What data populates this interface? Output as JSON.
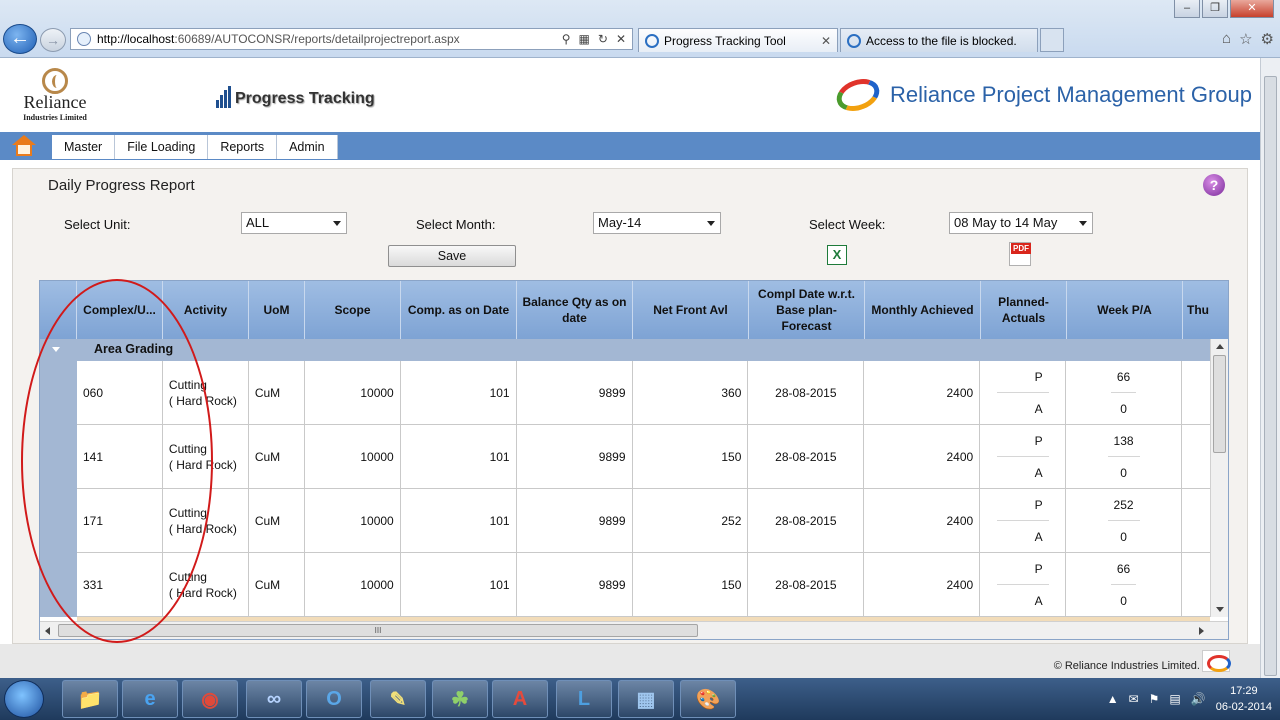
{
  "browser": {
    "url_host": "http://localhost",
    "url_rest": ":60689/AUTOCONSR/reports/detailprojectreport.aspx",
    "tabs": [
      {
        "label": "Progress Tracking Tool"
      },
      {
        "label": "Access to the file is blocked."
      }
    ]
  },
  "header": {
    "company_name": "Reliance",
    "company_sub": "Industries Limited",
    "app_title": "Progress Tracking",
    "brand": "Reliance Project Management Group"
  },
  "menu": [
    "Master",
    "File Loading",
    "Reports",
    "Admin"
  ],
  "report": {
    "title": "Daily Progress Report",
    "unit_label": "Select Unit:",
    "unit_value": "ALL",
    "month_label": "Select Month:",
    "month_value": "May-14",
    "week_label": "Select Week:",
    "week_value": "08 May to 14 May",
    "save_label": "Save"
  },
  "grid": {
    "columns": [
      "Complex/U...",
      "Activity",
      "UoM",
      "Scope",
      "Comp. as on Date",
      "Balance Qty as on date",
      "Net Front Avl",
      "Compl Date w.r.t. Base plan-Forecast",
      "Monthly Achieved",
      "Planned-Actuals",
      "Week P/A",
      "Thu"
    ],
    "group": "Area Grading",
    "rows": [
      {
        "complex": "060",
        "activity": "Cutting\n( Hard Rock)",
        "uom": "CuM",
        "scope": "10000",
        "comp": "101",
        "balance": "9899",
        "net_front": "360",
        "compl_date": "28-08-2015",
        "monthly": "2400",
        "p_label": "P",
        "a_label": "A",
        "week_p": "66",
        "week_a": "0"
      },
      {
        "complex": "141",
        "activity": "Cutting\n( Hard Rock)",
        "uom": "CuM",
        "scope": "10000",
        "comp": "101",
        "balance": "9899",
        "net_front": "150",
        "compl_date": "28-08-2015",
        "monthly": "2400",
        "p_label": "P",
        "a_label": "A",
        "week_p": "138",
        "week_a": "0"
      },
      {
        "complex": "171",
        "activity": "Cutting\n( Hard Rock)",
        "uom": "CuM",
        "scope": "10000",
        "comp": "101",
        "balance": "9899",
        "net_front": "252",
        "compl_date": "28-08-2015",
        "monthly": "2400",
        "p_label": "P",
        "a_label": "A",
        "week_p": "252",
        "week_a": "0"
      },
      {
        "complex": "331",
        "activity": "Cutting\n( Hard Rock)",
        "uom": "CuM",
        "scope": "10000",
        "comp": "101",
        "balance": "9899",
        "net_front": "150",
        "compl_date": "28-08-2015",
        "monthly": "2400",
        "p_label": "P",
        "a_label": "A",
        "week_p": "66",
        "week_a": "0"
      }
    ],
    "hscroll_grip": "III"
  },
  "footer": {
    "copyright": "© Reliance Industries Limited."
  },
  "taskbar": {
    "time": "17:29",
    "date": "06-02-2014"
  },
  "colors": {
    "menubar": "#5b8ac6",
    "header_grid": "#8fb0dc",
    "annotation": "#d11a1a",
    "brand_text": "#2b62a8"
  }
}
